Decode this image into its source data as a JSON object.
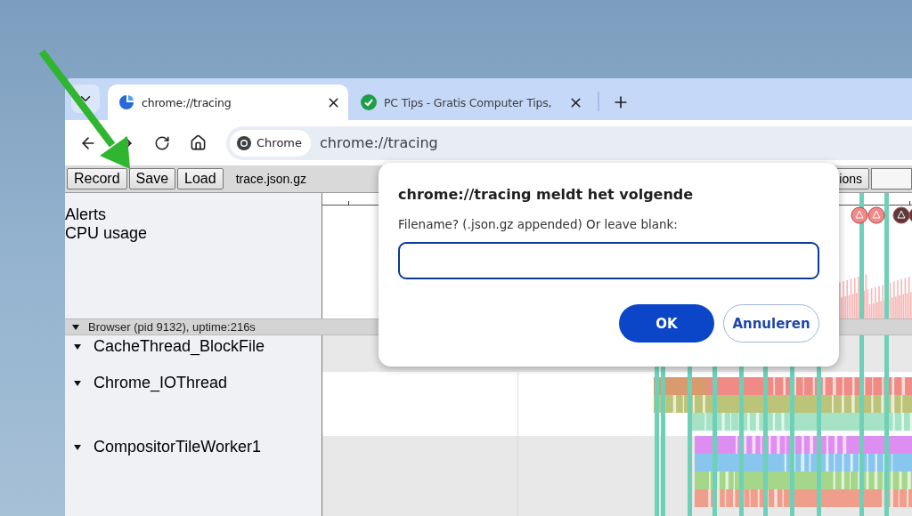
{
  "tabs": [
    {
      "title": "chrome://tracing",
      "selected": true,
      "kind": "tracing"
    },
    {
      "title": "PC Tips - Gratis Computer Tips,",
      "selected": false,
      "kind": "check"
    }
  ],
  "address_bar": {
    "site_chip": "Chrome",
    "url": "chrome://tracing"
  },
  "tracing_toolbar": {
    "buttons": [
      "Record",
      "Save",
      "Load"
    ],
    "filename": "trace.json.gz",
    "right_button": "ions"
  },
  "tracks": {
    "top_labels": [
      "Alerts",
      "CPU usage"
    ],
    "process": {
      "label": "Browser (pid 9132), uptime:216s",
      "expanded": true
    },
    "threads": [
      {
        "name": "CacheThread_BlockFile",
        "expanded": true
      },
      {
        "name": "Chrome_IOThread",
        "expanded": true
      },
      {
        "name": "CompositorTileWorker1",
        "expanded": true
      }
    ]
  },
  "dialog": {
    "title": "chrome://tracing meldt het volgende",
    "prompt": "Filename? (.json.gz appended) Or leave blank:",
    "buttons": [
      {
        "label": "OK",
        "kind": "primary"
      },
      {
        "label": "Annuleren",
        "kind": "secondary"
      }
    ]
  }
}
